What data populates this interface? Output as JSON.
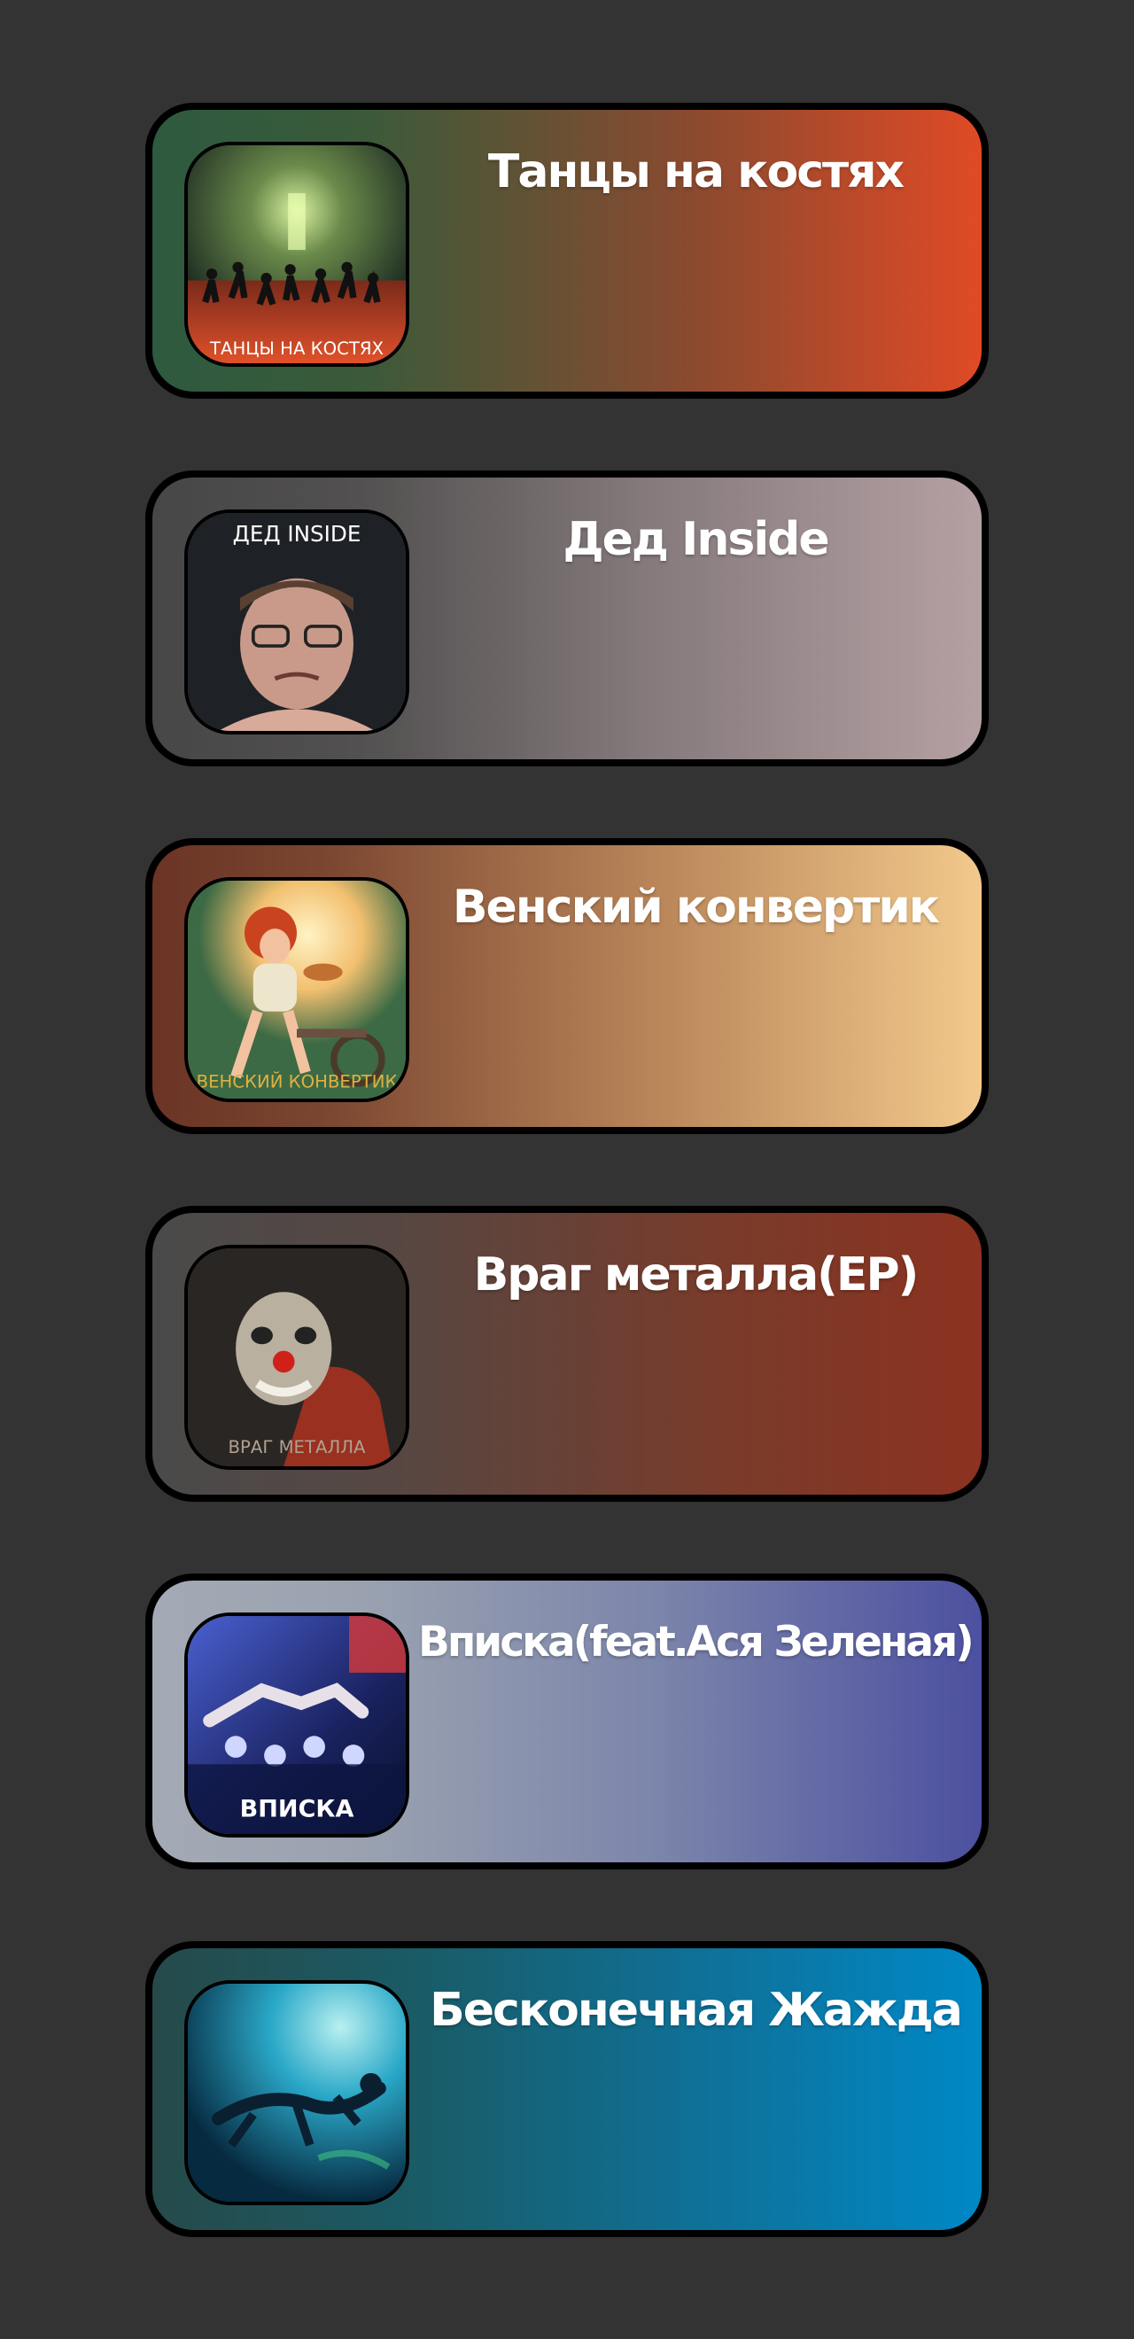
{
  "albums": [
    {
      "title": "Танцы на костях",
      "cover_text": "ТАНЦЫ НА КОСТЯХ",
      "gradient": [
        "#2e5a3f",
        "#e04a25"
      ]
    },
    {
      "title": "Дед Inside",
      "cover_text": "ДЕД INSIDE",
      "gradient": [
        "#4a4a4a",
        "#b5a0a3"
      ]
    },
    {
      "title": "Венский конвертик",
      "cover_text": "ВЕНСКИЙ КОНВЕРТИК",
      "gradient": [
        "#6b3425",
        "#f2c98c"
      ]
    },
    {
      "title": "Враг металла(EP)",
      "cover_text": "ВРАГ МЕТАЛЛА",
      "gradient": [
        "#4a4a4a",
        "#8c3220"
      ]
    },
    {
      "title": "Вписка(feat.Ася Зеленая)",
      "cover_text": "ВПИСКА",
      "gradient": [
        "#a3aab5",
        "#4c50a0"
      ]
    },
    {
      "title": "Бесконечная Жажда",
      "cover_text": "",
      "gradient": [
        "#254a4a",
        "#0088c6"
      ]
    }
  ]
}
